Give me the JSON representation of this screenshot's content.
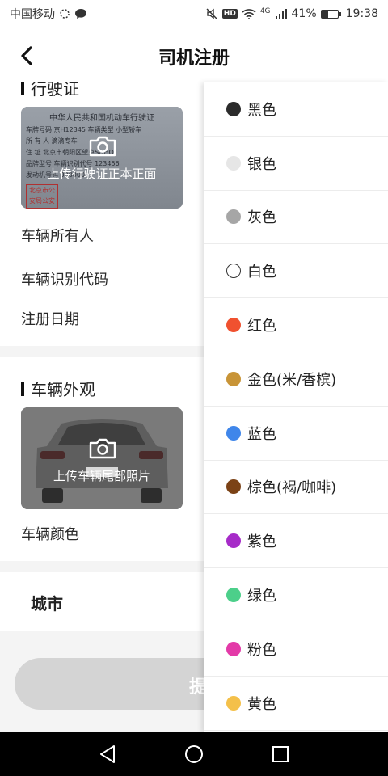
{
  "status_bar": {
    "carrier": "中国移动",
    "network": "4G",
    "battery": "41%",
    "battery_level": 0.41,
    "time": "19:38",
    "hd_badge": "HD"
  },
  "nav": {
    "title": "司机注册",
    "back_icon": "chevron-left-icon"
  },
  "form": {
    "license_section": {
      "title": "行驶证",
      "card_title": "中华人民共和国机动车行驶证",
      "card_lines": [
        "车牌号码  京H12345  车辆类型  小型轿车",
        "所 有 人  滴滴专车",
        "住   址  北京市朝阳区望京SOHO",
        "品牌型号                车辆识别代号 123456",
        "                        发动机号码   000000"
      ],
      "stamp": "北京市公安局公安",
      "upload_label": "上传行驶证正本正面",
      "fields": [
        "车辆所有人",
        "车辆识别代码",
        "注册日期"
      ]
    },
    "exterior_section": {
      "title": "车辆外观",
      "upload_label": "上传车辆尾部照片",
      "fields": [
        "车辆颜色"
      ]
    },
    "city_label": "城市",
    "submit_label": "提交"
  },
  "color_picker": {
    "options": [
      {
        "label": "黑色",
        "color": "#2b2b2b",
        "outline": false
      },
      {
        "label": "银色",
        "color": "#e6e6e6",
        "outline": false
      },
      {
        "label": "灰色",
        "color": "#a6a6a6",
        "outline": false
      },
      {
        "label": "白色",
        "color": "#ffffff",
        "outline": true
      },
      {
        "label": "红色",
        "color": "#f0512f",
        "outline": false
      },
      {
        "label": "金色(米/香槟)",
        "color": "#c89437",
        "outline": false
      },
      {
        "label": "蓝色",
        "color": "#3f86ea",
        "outline": false
      },
      {
        "label": "棕色(褐/咖啡)",
        "color": "#7b4216",
        "outline": false
      },
      {
        "label": "紫色",
        "color": "#a62bc8",
        "outline": false
      },
      {
        "label": "绿色",
        "color": "#4ccf8a",
        "outline": false
      },
      {
        "label": "粉色",
        "color": "#e33aa8",
        "outline": false
      },
      {
        "label": "黄色",
        "color": "#f4c04a",
        "outline": false
      }
    ]
  },
  "system_nav": {
    "buttons": [
      "back-triangle-icon",
      "home-circle-icon",
      "recents-square-icon"
    ]
  }
}
